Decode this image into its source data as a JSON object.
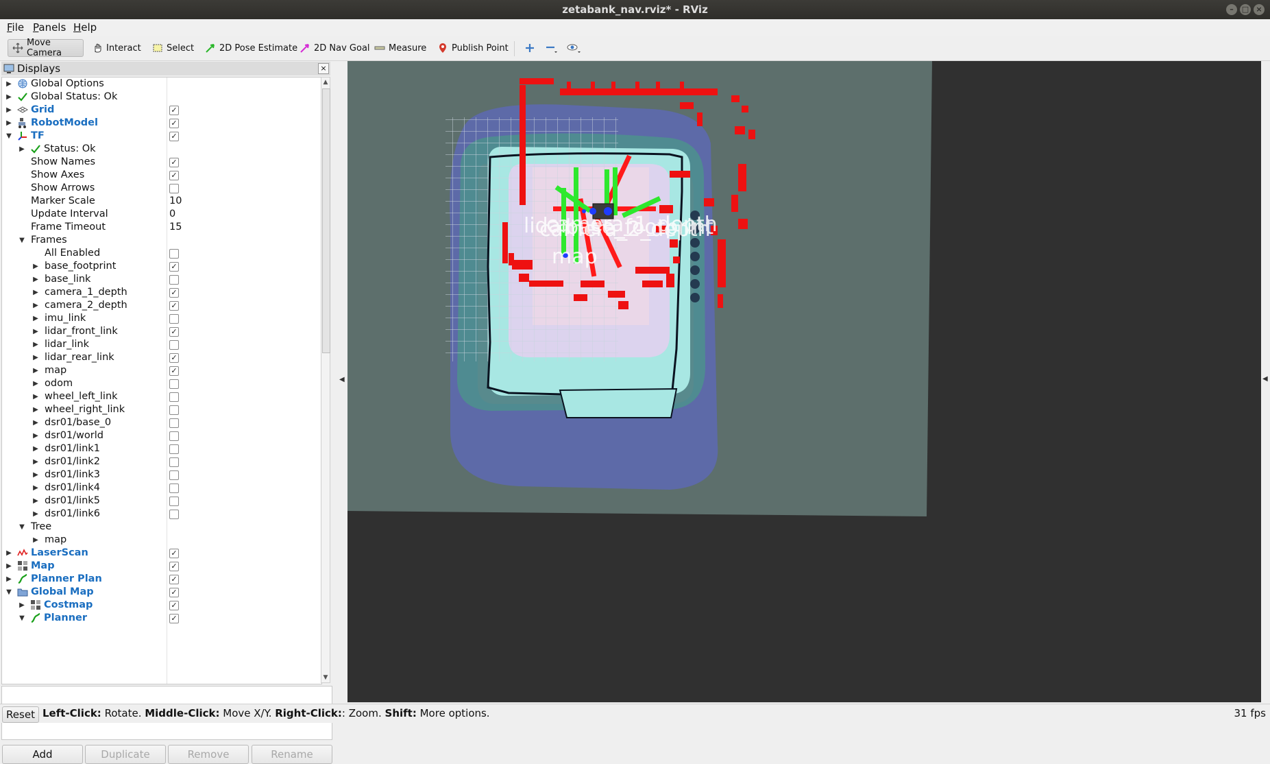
{
  "window": {
    "title": "zetabank_nav.rviz* - RViz"
  },
  "menu": {
    "items": [
      "File",
      "Panels",
      "Help"
    ]
  },
  "toolbar": {
    "tools": [
      "Move Camera",
      "Interact",
      "Select",
      "2D Pose Estimate",
      "2D Nav Goal",
      "Measure",
      "Publish Point"
    ],
    "active": "Move Camera"
  },
  "displays": {
    "title": "Displays",
    "rows": [
      {
        "label": "Global Options",
        "level": 0,
        "arrow": "closed",
        "icon": "globe-icon"
      },
      {
        "label": "Global Status: Ok",
        "level": 0,
        "arrow": "closed",
        "icon": "check-icon"
      },
      {
        "label": "Grid",
        "level": 0,
        "arrow": "closed",
        "icon": "grid-icon",
        "blue": true,
        "checked": true
      },
      {
        "label": "RobotModel",
        "level": 0,
        "arrow": "closed",
        "icon": "robot-icon",
        "blue": true,
        "checked": true
      },
      {
        "label": "TF",
        "level": 0,
        "arrow": "open",
        "icon": "tf-icon",
        "blue": true,
        "checked": true
      },
      {
        "label": "Status: Ok",
        "level": 1,
        "arrow": "closed",
        "icon": "check-icon"
      },
      {
        "label": "Show Names",
        "level": 1,
        "checked": true
      },
      {
        "label": "Show Axes",
        "level": 1,
        "checked": true
      },
      {
        "label": "Show Arrows",
        "level": 1,
        "checked": false
      },
      {
        "label": "Marker Scale",
        "level": 1,
        "value": "10"
      },
      {
        "label": "Update Interval",
        "level": 1,
        "value": "0"
      },
      {
        "label": "Frame Timeout",
        "level": 1,
        "value": "15"
      },
      {
        "label": "Frames",
        "level": 1,
        "arrow": "open"
      },
      {
        "label": "All Enabled",
        "level": 2,
        "checked": false
      },
      {
        "label": "base_footprint",
        "level": 2,
        "arrow": "closed",
        "checked": true
      },
      {
        "label": "base_link",
        "level": 2,
        "arrow": "closed",
        "checked": false
      },
      {
        "label": "camera_1_depth",
        "level": 2,
        "arrow": "closed",
        "checked": true
      },
      {
        "label": "camera_2_depth",
        "level": 2,
        "arrow": "closed",
        "checked": true
      },
      {
        "label": "imu_link",
        "level": 2,
        "arrow": "closed",
        "checked": false
      },
      {
        "label": "lidar_front_link",
        "level": 2,
        "arrow": "closed",
        "checked": true
      },
      {
        "label": "lidar_link",
        "level": 2,
        "arrow": "closed",
        "checked": false
      },
      {
        "label": "lidar_rear_link",
        "level": 2,
        "arrow": "closed",
        "checked": true
      },
      {
        "label": "map",
        "level": 2,
        "arrow": "closed",
        "checked": true
      },
      {
        "label": "odom",
        "level": 2,
        "arrow": "closed",
        "checked": false
      },
      {
        "label": "wheel_left_link",
        "level": 2,
        "arrow": "closed",
        "checked": false
      },
      {
        "label": "wheel_right_link",
        "level": 2,
        "arrow": "closed",
        "checked": false
      },
      {
        "label": "dsr01/base_0",
        "level": 2,
        "arrow": "closed",
        "checked": false
      },
      {
        "label": "dsr01/world",
        "level": 2,
        "arrow": "closed",
        "checked": false
      },
      {
        "label": "dsr01/link1",
        "level": 2,
        "arrow": "closed",
        "checked": false
      },
      {
        "label": "dsr01/link2",
        "level": 2,
        "arrow": "closed",
        "checked": false
      },
      {
        "label": "dsr01/link3",
        "level": 2,
        "arrow": "closed",
        "checked": false
      },
      {
        "label": "dsr01/link4",
        "level": 2,
        "arrow": "closed",
        "checked": false
      },
      {
        "label": "dsr01/link5",
        "level": 2,
        "arrow": "closed",
        "checked": false
      },
      {
        "label": "dsr01/link6",
        "level": 2,
        "arrow": "closed",
        "checked": false
      },
      {
        "label": "Tree",
        "level": 1,
        "arrow": "open"
      },
      {
        "label": "map",
        "level": 2,
        "arrow": "closed"
      },
      {
        "label": "LaserScan",
        "level": 0,
        "arrow": "closed",
        "icon": "laserscan-icon",
        "blue": true,
        "checked": true
      },
      {
        "label": "Map",
        "level": 0,
        "arrow": "closed",
        "icon": "map-icon",
        "blue": true,
        "checked": true
      },
      {
        "label": "Planner Plan",
        "level": 0,
        "arrow": "closed",
        "icon": "path-icon",
        "blue": true,
        "checked": true
      },
      {
        "label": "Global Map",
        "level": 0,
        "arrow": "open",
        "icon": "folder-icon",
        "blue": true,
        "checked": true
      },
      {
        "label": "Costmap",
        "level": 1,
        "arrow": "closed",
        "icon": "map-icon",
        "blue": true,
        "checked": true
      },
      {
        "label": "Planner",
        "level": 1,
        "arrow": "open",
        "icon": "path-icon",
        "blue": true,
        "checked": true
      }
    ]
  },
  "panel_buttons": {
    "add": "Add",
    "duplicate": "Duplicate",
    "remove": "Remove",
    "rename": "Rename"
  },
  "status": {
    "reset": "Reset",
    "hint_parts": [
      {
        "bold": "Left-Click:",
        "text": " Rotate. "
      },
      {
        "bold": "Middle-Click:",
        "text": " Move X/Y. "
      },
      {
        "bold": "Right-Click:",
        "text": ": Zoom. "
      },
      {
        "bold": "Shift:",
        "text": " More options."
      }
    ],
    "fps": "31 fps"
  },
  "viewport": {
    "frame_labels": [
      "lidar",
      "camera_2_depth",
      "camera_1_depth",
      "base_footprint",
      "map"
    ]
  }
}
